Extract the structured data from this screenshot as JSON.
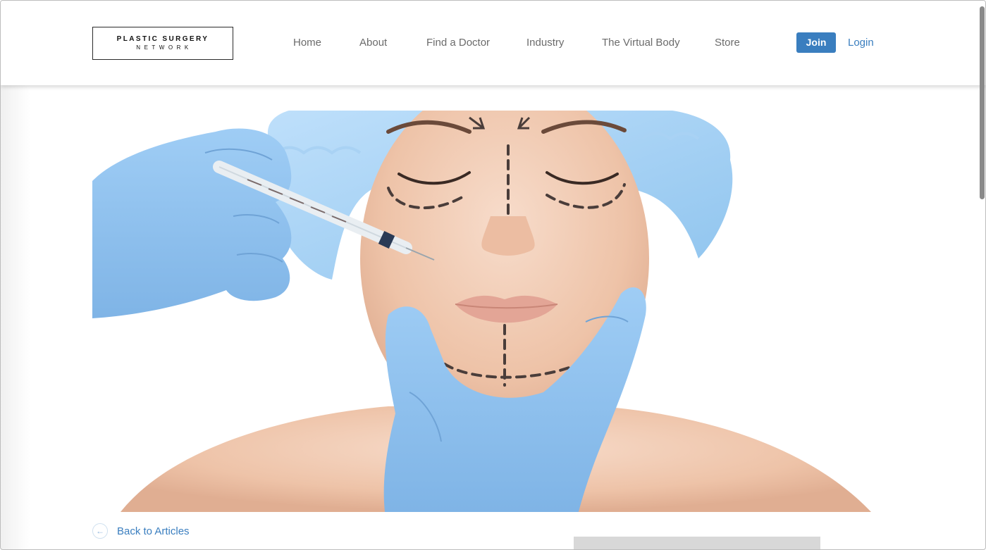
{
  "logo": {
    "line1": "PLASTIC SURGERY",
    "line2": "NETWORK"
  },
  "nav": {
    "items": [
      {
        "label": "Home"
      },
      {
        "label": "About"
      },
      {
        "label": "Find a Doctor"
      },
      {
        "label": "Industry"
      },
      {
        "label": "The Virtual Body"
      },
      {
        "label": "Store"
      }
    ],
    "join_label": "Join",
    "login_label": "Login"
  },
  "hero": {
    "icon": "hero-image-icon"
  },
  "article": {
    "back_label": "Back to Articles",
    "back_icon": "arrow-left-icon"
  },
  "colors": {
    "accent": "#3a7ebf",
    "nav_text": "#6b6b6b",
    "glove": "#8fc0ec"
  }
}
